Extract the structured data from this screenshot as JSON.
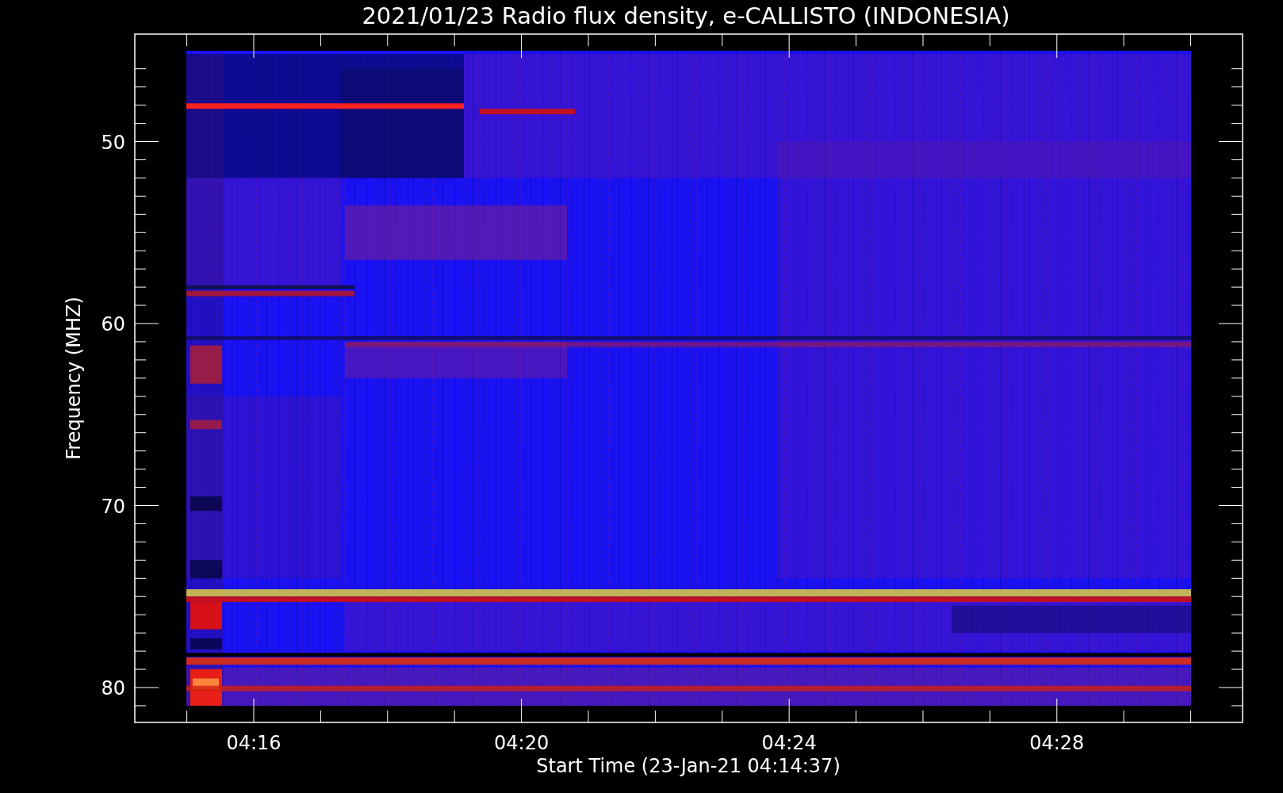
{
  "title": "2021/01/23  Radio flux density, e-CALLISTO (INDONESIA)",
  "y_axis": {
    "label": "Frequency (MHZ)",
    "ticks": [
      "50",
      "60",
      "70",
      "80"
    ]
  },
  "x_axis": {
    "label": "Start Time (23-Jan-21 04:14:37)",
    "ticks": [
      "04:16",
      "04:20",
      "04:24",
      "04:28"
    ]
  }
}
